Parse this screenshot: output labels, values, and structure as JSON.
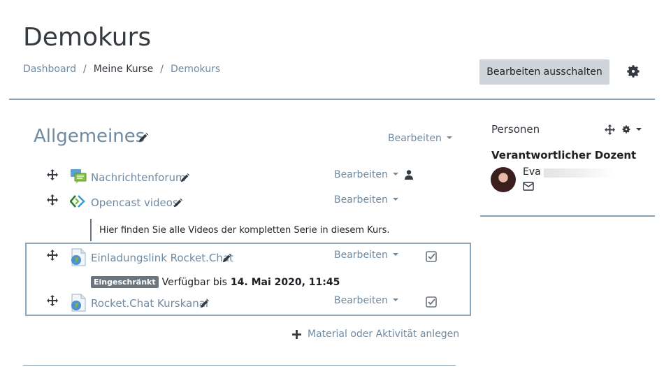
{
  "page": {
    "title": "Demokurs"
  },
  "breadcrumb": {
    "items": [
      "Dashboard",
      "Meine Kurse",
      "Demokurs"
    ],
    "separator": "/"
  },
  "header": {
    "edit_toggle_label": "Bearbeiten ausschalten",
    "settings_icon": "gear-icon"
  },
  "section": {
    "title": "Allgemeines",
    "edit_menu_label": "Bearbeiten",
    "activities": [
      {
        "name": "Nachrichtenforum",
        "type_icon": "forum-icon",
        "edit_label": "Bearbeiten",
        "extra_icon": "person-icon"
      },
      {
        "name": "Opencast videos",
        "type_icon": "opencast-icon",
        "edit_label": "Bearbeiten",
        "description": "Hier finden Sie alle Videos der kompletten Serie in diesem Kurs."
      },
      {
        "name": "Einladungslink Rocket.Chat",
        "type_icon": "url-icon",
        "edit_label": "Bearbeiten",
        "completion_icon": "checkbox-icon",
        "restriction_badge": "Eingeschränkt",
        "restriction_text": "Verfügbar bis",
        "restriction_date": "14. Mai 2020, 11:45"
      },
      {
        "name": "Rocket.Chat Kurskanal",
        "type_icon": "url-icon",
        "edit_label": "Bearbeiten",
        "completion_icon": "checkbox-icon"
      }
    ],
    "add_activity_label": "Material oder Aktivität anlegen"
  },
  "people_block": {
    "title": "Personen",
    "role": "Verantwortlicher Dozent",
    "teacher_name": "Eva",
    "mail_icon": "envelope-icon"
  },
  "colors": {
    "link": "#6f8aa1",
    "divider": "#8aa1b3",
    "button": "#ced4da",
    "text": "#343a40"
  }
}
